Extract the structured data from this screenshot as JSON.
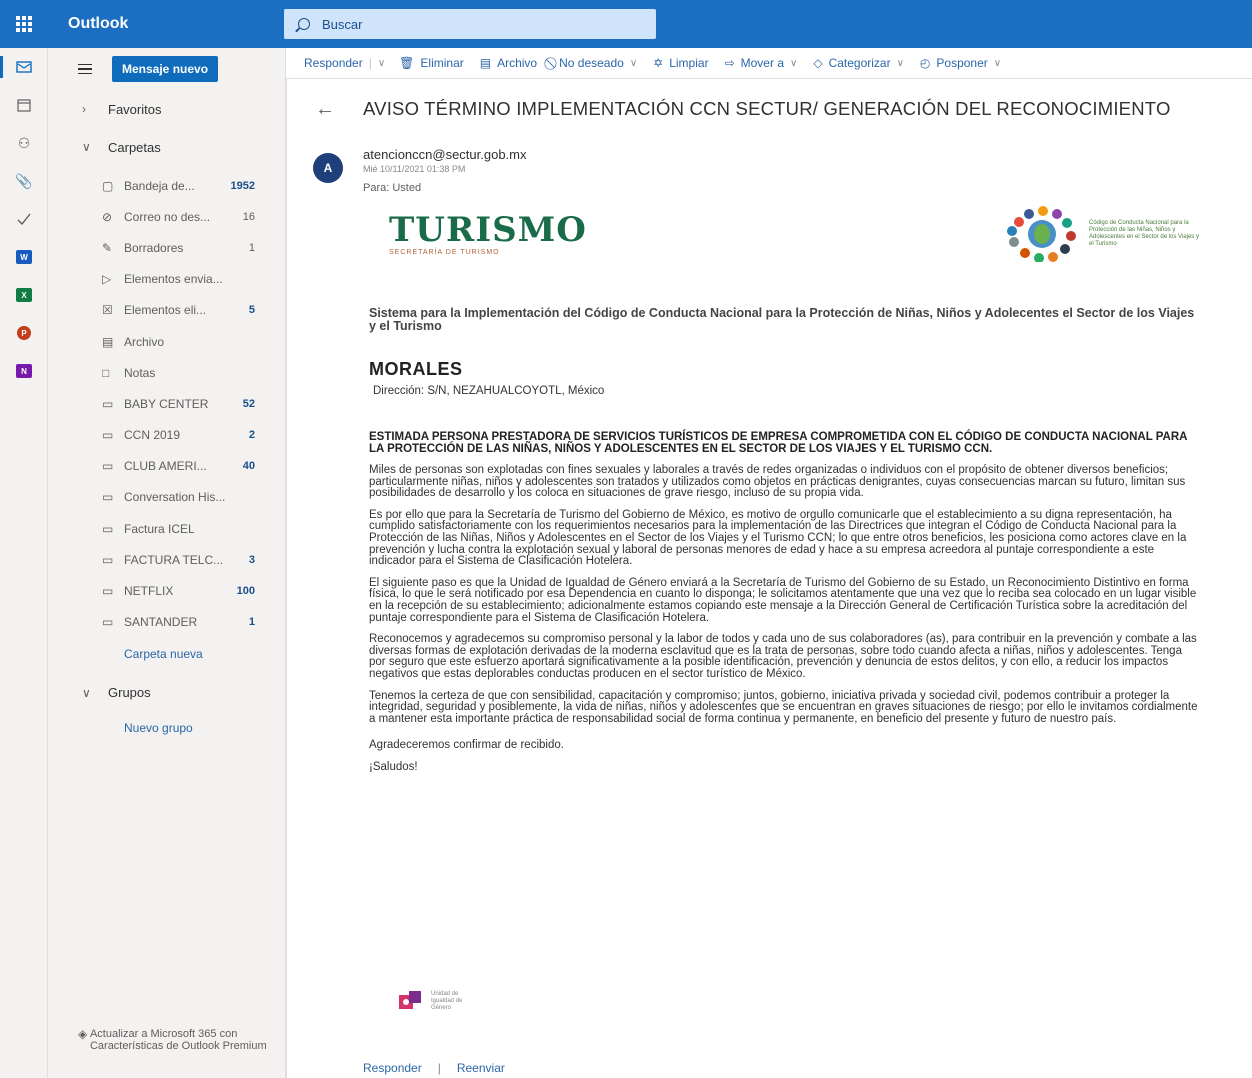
{
  "app": {
    "name": "Outlook"
  },
  "search": {
    "placeholder": "Buscar"
  },
  "compose": {
    "new_label": "Mensaje nuevo"
  },
  "nav": {
    "favorites": "Favoritos",
    "folders_heading": "Carpetas",
    "folders": [
      {
        "name": "Bandeja de...",
        "count": "1952",
        "bold": true,
        "icon": "inbox-icon"
      },
      {
        "name": "Correo no des...",
        "count": "16",
        "bold": false,
        "icon": "junk-icon"
      },
      {
        "name": "Borradores",
        "count": "1",
        "bold": false,
        "icon": "pencil-icon"
      },
      {
        "name": "Elementos envia...",
        "count": "",
        "bold": false,
        "icon": "send-icon"
      },
      {
        "name": "Elementos eli...",
        "count": "5",
        "bold": true,
        "icon": "trash-icon"
      },
      {
        "name": "Archivo",
        "count": "",
        "bold": false,
        "icon": "archive-icon"
      },
      {
        "name": "Notas",
        "count": "",
        "bold": false,
        "icon": "note-icon"
      },
      {
        "name": "BABY CENTER",
        "count": "52",
        "bold": true,
        "icon": "folder-icon"
      },
      {
        "name": "CCN 2019",
        "count": "2",
        "bold": true,
        "icon": "folder-icon"
      },
      {
        "name": "CLUB AMERI...",
        "count": "40",
        "bold": true,
        "icon": "folder-icon"
      },
      {
        "name": "Conversation His...",
        "count": "",
        "bold": false,
        "icon": "folder-icon"
      },
      {
        "name": "Factura ICEL",
        "count": "",
        "bold": false,
        "icon": "folder-icon"
      },
      {
        "name": "FACTURA TELC...",
        "count": "3",
        "bold": true,
        "icon": "folder-icon"
      },
      {
        "name": "NETFLIX",
        "count": "100",
        "bold": true,
        "icon": "folder-icon"
      },
      {
        "name": "SANTANDER",
        "count": "1",
        "bold": true,
        "icon": "folder-icon"
      }
    ],
    "new_folder": "Carpeta nueva",
    "groups_heading": "Grupos",
    "new_group": "Nuevo grupo",
    "upgrade": "Actualizar a Microsoft 365 con Características de Outlook Premium"
  },
  "toolbar": {
    "reply": "Responder",
    "delete": "Eliminar",
    "archive": "Archivo",
    "junk": "No deseado",
    "sweep": "Limpiar",
    "move": "Mover a",
    "categorize": "Categorizar",
    "snooze": "Posponer"
  },
  "message": {
    "subject": "AVISO TÉRMINO IMPLEMENTACIÓN CCN SECTUR/ GENERACIÓN DEL RECONOCIMIENTO",
    "avatar_initial": "A",
    "from": "atencionccn@sectur.gob.mx",
    "date": "Mié 10/11/2021 01:38 PM",
    "to": "Para: Usted",
    "logo_title": "TURISMO",
    "logo_subtitle": "SECRETARÍA DE TURISMO",
    "ccn_logo_text": "Código de Conducta Nacional para la Protección de las Niñas, Niños y Adolescentes en el Sector de los Viajes y el Turismo",
    "intro": "Sistema para la Implementación del Código de Conducta Nacional para la Protección de Niñas, Niños y Adolecentes el Sector de los Viajes y el Turismo",
    "org_name": "MORALES",
    "address": "Dirección: S/N, NEZAHUALCOYOTL, México",
    "greeting": "ESTIMADA PERSONA PRESTADORA DE SERVICIOS TURÍSTICOS DE EMPRESA COMPROMETIDA CON EL CÓDIGO DE CONDUCTA NACIONAL PARA LA PROTECCIÓN DE LAS NIÑAS, NIÑOS Y ADOLESCENTES EN EL SECTOR DE LOS VIAJES Y EL TURISMO CCN.",
    "paragraphs": [
      "Miles de personas son explotadas con fines sexuales y laborales a través de redes organizadas o individuos con el propósito de obtener diversos beneficios; particularmente niñas, niños y adolescentes son tratados y utilizados como objetos en prácticas denigrantes, cuyas consecuencias marcan su futuro, limitan sus posibilidades de desarrollo y los coloca en situaciones de grave riesgo, incluso de su propia vida.",
      "Es por ello que para la Secretaría de Turismo del Gobierno de México, es motivo de orgullo comunicarle que el establecimiento a su digna representación, ha cumplido satisfactoriamente con los requerimientos necesarios para la implementación de las Directrices que integran el Código de Conducta Nacional para la Protección de las Niñas, Niños y Adolescentes en el Sector de los Viajes y el Turismo CCN; lo que entre otros beneficios, les posiciona como actores clave en la prevención y lucha contra la explotación sexual y laboral de personas menores de edad y hace a su empresa acreedora al puntaje correspondiente a este indicador para el Sistema de Clasificación Hotelera.",
      "El siguiente paso es que la Unidad de Igualdad de Género enviará a la Secretaría de Turismo del Gobierno de su Estado, un Reconocimiento Distintivo en forma física, lo que le será notificado por esa Dependencia en cuanto lo disponga; le solicitamos atentamente que una vez que lo reciba sea colocado en un lugar visible en la recepción de su establecimiento; adicionalmente estamos copiando este mensaje a la Dirección General de Certificación Turística sobre la acreditación del puntaje correspondiente para el Sistema de Clasificación Hotelera.",
      "Reconocemos y agradecemos su compromiso personal y la labor de todos y cada uno de sus colaboradores (as), para contribuir en la prevención y combate a las diversas formas de explotación derivadas de la moderna esclavitud que es la trata de personas, sobre todo cuando afecta a niñas, niños y adolescentes. Tenga por seguro que este esfuerzo aportará significativamente a la posible identificación, prevención y denuncia de estos delitos, y con ello, a reducir los impactos negativos que estas deplorables conductas producen en el sector turístico de México.",
      "Tenemos la certeza de que con sensibilidad, capacitación y compromiso; juntos, gobierno, iniciativa privada y sociedad civil, podemos contribuir a proteger la integridad, seguridad y posiblemente, la vida de niñas, niños y adolescentes que se encuentran en graves situaciones de riesgo; por ello le invitamos cordialmente a mantener esta importante práctica de responsabilidad social de forma continua y permanente, en beneficio del presente y futuro de nuestro país."
    ],
    "thanks": "Agradeceremos confirmar de recibido.",
    "closing": "¡Saludos!",
    "igualdad_logo_text": "Unidad de Igualdad de Género",
    "reply_link": "Responder",
    "forward_link": "Reenviar"
  },
  "colors": {
    "brand": "#1b6ec2",
    "accent": "#0f6cbd",
    "link": "#2b66a8",
    "turismo_green": "#1a6b4a"
  }
}
